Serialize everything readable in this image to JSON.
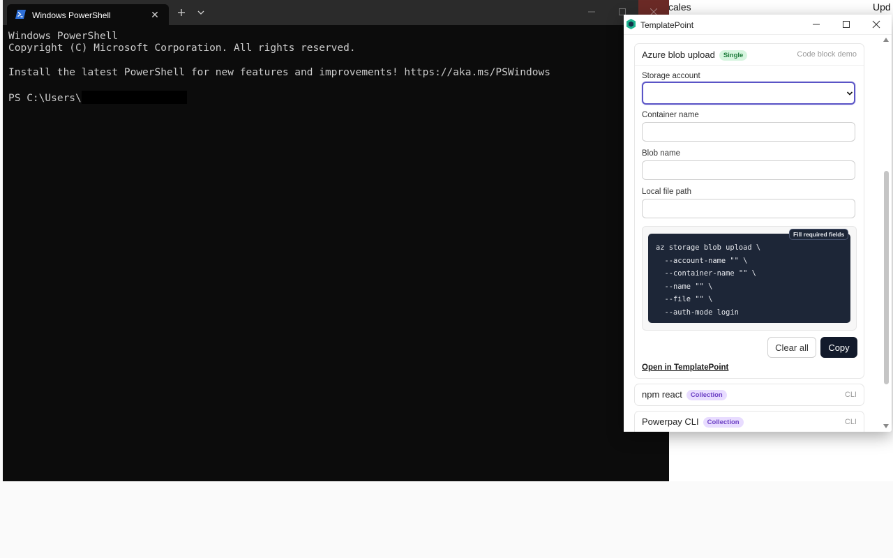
{
  "background": {
    "text_left": "cales",
    "text_right": "Upd"
  },
  "terminal": {
    "tab_title": "Windows PowerShell",
    "lines": [
      "Windows PowerShell",
      "Copyright (C) Microsoft Corporation. All rights reserved.",
      "",
      "Install the latest PowerShell for new features and improvements! https://aka.ms/PSWindows",
      ""
    ],
    "prompt": "PS C:\\Users\\"
  },
  "templatepoint": {
    "window_title": "TemplatePoint",
    "active_card": {
      "title": "Azure blob upload",
      "badge": "Single",
      "meta": "Code block demo",
      "fields": [
        {
          "label": "Storage account",
          "value": ""
        },
        {
          "label": "Container name",
          "value": ""
        },
        {
          "label": "Blob name",
          "value": ""
        },
        {
          "label": "Local file path",
          "value": ""
        }
      ],
      "code_pill": "Fill required fields",
      "code": "az storage blob upload \\\n  --account-name \"\" \\\n  --container-name \"\" \\\n  --name \"\" \\\n  --file \"\" \\\n  --auth-mode login",
      "clear_label": "Clear all",
      "copy_label": "Copy",
      "open_link": "Open in TemplatePoint"
    },
    "other_cards": [
      {
        "title": "npm react",
        "badge": "Collection",
        "meta": "CLI"
      },
      {
        "title": "Powerpay CLI",
        "badge": "Collection",
        "meta": "CLI"
      }
    ]
  },
  "colors": {
    "terminal_bg": "#0c0c0c",
    "accent_focus": "#5a54c6",
    "code_bg": "#1d2637",
    "primary_button": "#121a2b",
    "single_badge": "#d6f5df",
    "collection_badge": "#e8dcff"
  }
}
